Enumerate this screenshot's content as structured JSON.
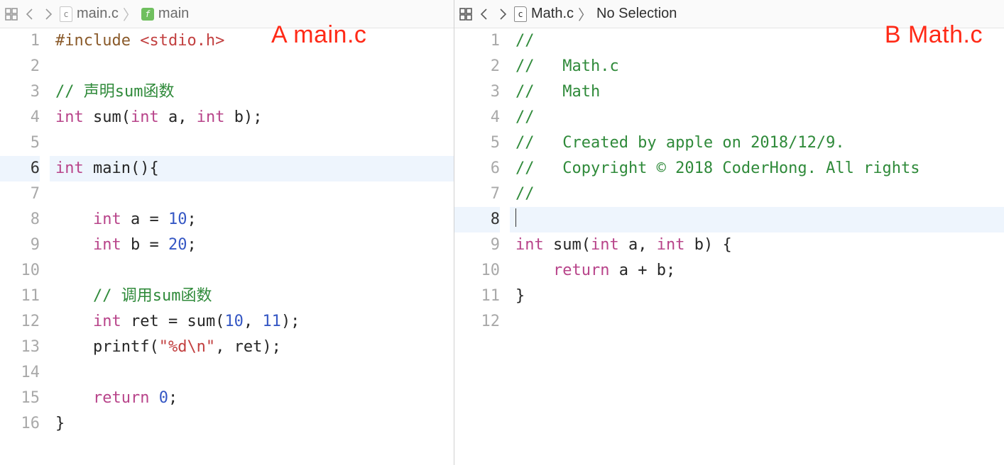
{
  "panes": {
    "left": {
      "breadcrumb": {
        "file_icon": "c",
        "file": "main.c",
        "func_icon": "f",
        "symbol": "main"
      },
      "annotation": "A  main.c",
      "current_line": 6,
      "lines": [
        {
          "n": 1,
          "tokens": [
            {
              "t": "#include ",
              "c": "pp"
            },
            {
              "t": "<stdio.h>",
              "c": "inc"
            }
          ]
        },
        {
          "n": 2,
          "tokens": []
        },
        {
          "n": 3,
          "tokens": [
            {
              "t": "// 声明sum函数",
              "c": "cm"
            }
          ]
        },
        {
          "n": 4,
          "tokens": [
            {
              "t": "int",
              "c": "kw"
            },
            {
              "t": " sum(",
              "c": "id"
            },
            {
              "t": "int",
              "c": "kw"
            },
            {
              "t": " a, ",
              "c": "id"
            },
            {
              "t": "int",
              "c": "kw"
            },
            {
              "t": " b);",
              "c": "id"
            }
          ]
        },
        {
          "n": 5,
          "tokens": []
        },
        {
          "n": 6,
          "tokens": [
            {
              "t": "int",
              "c": "kw"
            },
            {
              "t": " main(){",
              "c": "id"
            }
          ]
        },
        {
          "n": 7,
          "tokens": []
        },
        {
          "n": 8,
          "tokens": [
            {
              "t": "    ",
              "c": "id"
            },
            {
              "t": "int",
              "c": "kw"
            },
            {
              "t": " a = ",
              "c": "id"
            },
            {
              "t": "10",
              "c": "num"
            },
            {
              "t": ";",
              "c": "id"
            }
          ]
        },
        {
          "n": 9,
          "tokens": [
            {
              "t": "    ",
              "c": "id"
            },
            {
              "t": "int",
              "c": "kw"
            },
            {
              "t": " b = ",
              "c": "id"
            },
            {
              "t": "20",
              "c": "num"
            },
            {
              "t": ";",
              "c": "id"
            }
          ]
        },
        {
          "n": 10,
          "tokens": []
        },
        {
          "n": 11,
          "tokens": [
            {
              "t": "    ",
              "c": "id"
            },
            {
              "t": "// 调用sum函数",
              "c": "cm"
            }
          ]
        },
        {
          "n": 12,
          "tokens": [
            {
              "t": "    ",
              "c": "id"
            },
            {
              "t": "int",
              "c": "kw"
            },
            {
              "t": " ret = sum(",
              "c": "id"
            },
            {
              "t": "10",
              "c": "num"
            },
            {
              "t": ", ",
              "c": "id"
            },
            {
              "t": "11",
              "c": "num"
            },
            {
              "t": ");",
              "c": "id"
            }
          ]
        },
        {
          "n": 13,
          "tokens": [
            {
              "t": "    printf(",
              "c": "id"
            },
            {
              "t": "\"%d\\n\"",
              "c": "str"
            },
            {
              "t": ", ret);",
              "c": "id"
            }
          ]
        },
        {
          "n": 14,
          "tokens": []
        },
        {
          "n": 15,
          "tokens": [
            {
              "t": "    ",
              "c": "id"
            },
            {
              "t": "return",
              "c": "kw"
            },
            {
              "t": " ",
              "c": "id"
            },
            {
              "t": "0",
              "c": "num"
            },
            {
              "t": ";",
              "c": "id"
            }
          ]
        },
        {
          "n": 16,
          "tokens": [
            {
              "t": "}",
              "c": "id"
            }
          ]
        }
      ]
    },
    "right": {
      "breadcrumb": {
        "file_icon": "c",
        "file": "Math.c",
        "symbol": "No Selection"
      },
      "annotation": "B Math.c",
      "current_line": 8,
      "lines": [
        {
          "n": 1,
          "tokens": [
            {
              "t": "//",
              "c": "cm"
            }
          ]
        },
        {
          "n": 2,
          "tokens": [
            {
              "t": "//   Math.c",
              "c": "cm"
            }
          ]
        },
        {
          "n": 3,
          "tokens": [
            {
              "t": "//   Math",
              "c": "cm"
            }
          ]
        },
        {
          "n": 4,
          "tokens": [
            {
              "t": "//",
              "c": "cm"
            }
          ]
        },
        {
          "n": 5,
          "tokens": [
            {
              "t": "//   Created by apple on 2018/12/9.",
              "c": "cm"
            }
          ]
        },
        {
          "n": 6,
          "tokens": [
            {
              "t": "//   Copyright © 2018 CoderHong. All rights",
              "c": "cm"
            }
          ]
        },
        {
          "n": 7,
          "tokens": [
            {
              "t": "//",
              "c": "cm"
            }
          ]
        },
        {
          "n": 8,
          "tokens": [],
          "cursor": true
        },
        {
          "n": 9,
          "tokens": [
            {
              "t": "int",
              "c": "kw"
            },
            {
              "t": " sum(",
              "c": "id"
            },
            {
              "t": "int",
              "c": "kw"
            },
            {
              "t": " a, ",
              "c": "id"
            },
            {
              "t": "int",
              "c": "kw"
            },
            {
              "t": " b) {",
              "c": "id"
            }
          ]
        },
        {
          "n": 10,
          "tokens": [
            {
              "t": "    ",
              "c": "id"
            },
            {
              "t": "return",
              "c": "kw"
            },
            {
              "t": " a + b;",
              "c": "id"
            }
          ]
        },
        {
          "n": 11,
          "tokens": [
            {
              "t": "}",
              "c": "id"
            }
          ]
        },
        {
          "n": 12,
          "tokens": []
        }
      ]
    }
  }
}
